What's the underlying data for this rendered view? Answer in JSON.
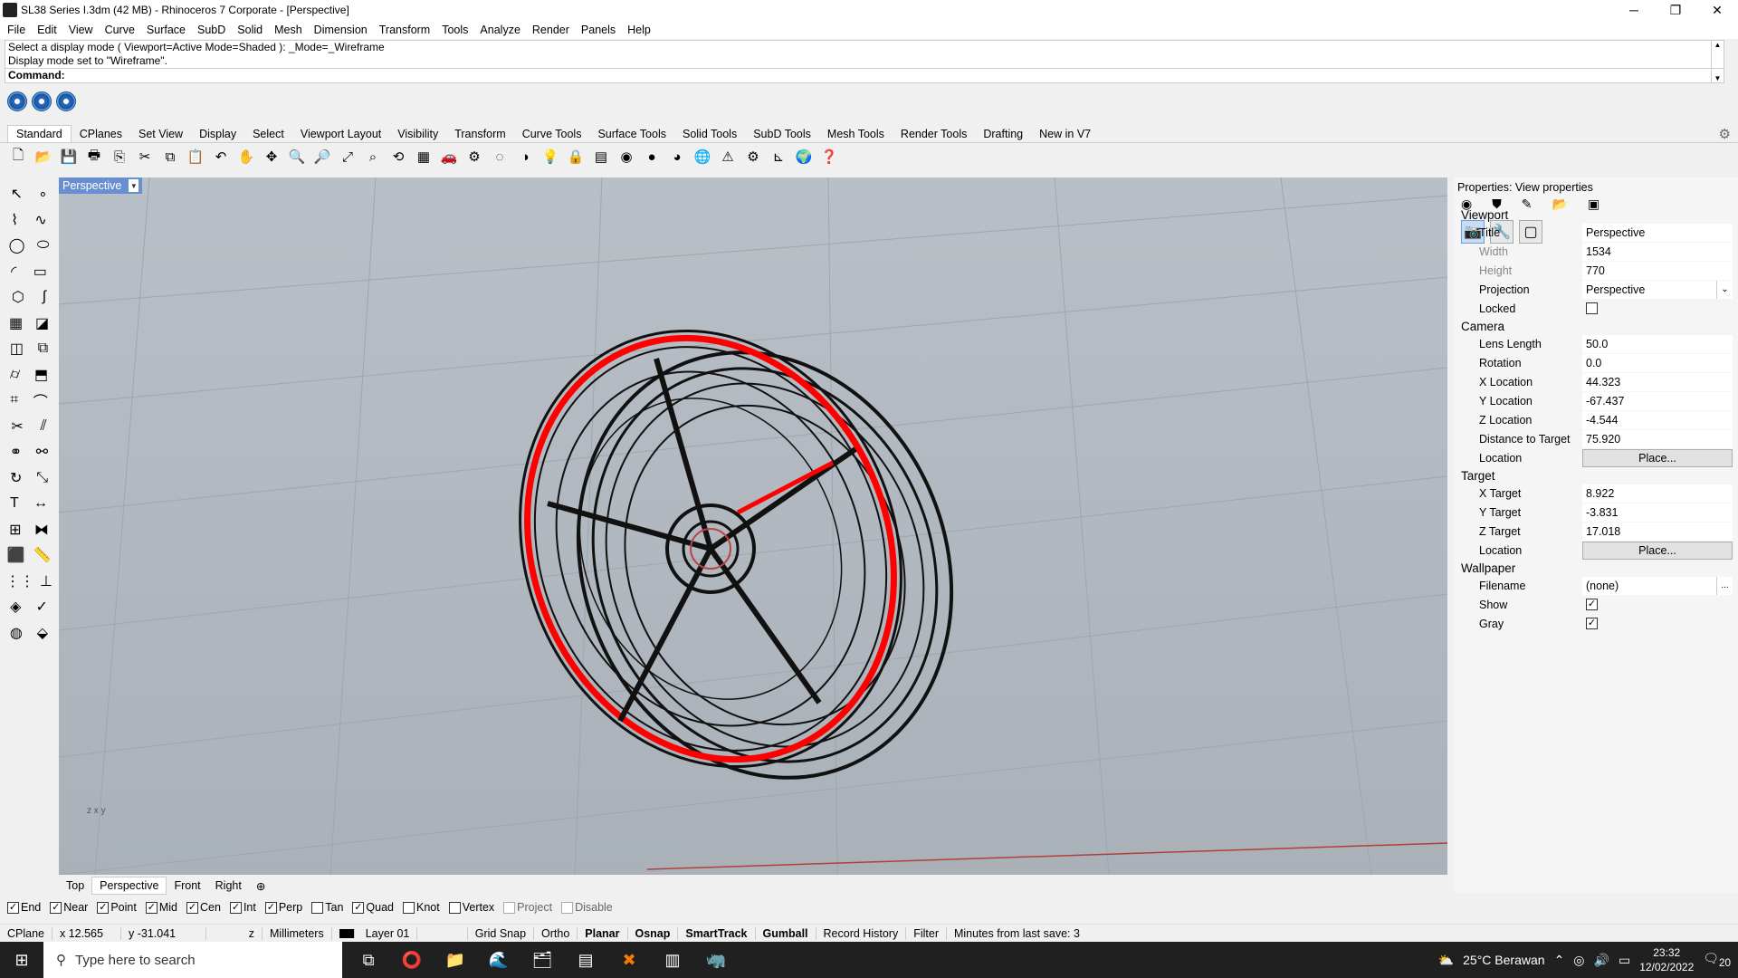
{
  "window": {
    "title": "SL38 Series I.3dm (42 MB) - Rhinoceros 7 Corporate - [Perspective]"
  },
  "menu": [
    "File",
    "Edit",
    "View",
    "Curve",
    "Surface",
    "SubD",
    "Solid",
    "Mesh",
    "Dimension",
    "Transform",
    "Tools",
    "Analyze",
    "Render",
    "Panels",
    "Help"
  ],
  "command": {
    "history1": "Select a display mode ( Viewport=Active  Mode=Shaded ): _Mode=_Wireframe",
    "history2": "Display mode set to \"Wireframe\".",
    "prompt": "Command:"
  },
  "tabs": [
    "Standard",
    "CPlanes",
    "Set View",
    "Display",
    "Select",
    "Viewport Layout",
    "Visibility",
    "Transform",
    "Curve Tools",
    "Surface Tools",
    "Solid Tools",
    "SubD Tools",
    "Mesh Tools",
    "Render Tools",
    "Drafting",
    "New in V7"
  ],
  "viewport": {
    "name": "Perspective",
    "axis_z": "z",
    "axis_x": "x",
    "axis_y": "y"
  },
  "viewtabs": [
    "Top",
    "Perspective",
    "Front",
    "Right"
  ],
  "properties": {
    "header": "Properties: View properties",
    "viewport_section": "Viewport",
    "title_label": "Title",
    "title_value": "Perspective",
    "width_label": "Width",
    "width_value": "1534",
    "height_label": "Height",
    "height_value": "770",
    "projection_label": "Projection",
    "projection_value": "Perspective",
    "locked_label": "Locked",
    "camera_section": "Camera",
    "lens_label": "Lens Length",
    "lens_value": "50.0",
    "rotation_label": "Rotation",
    "rotation_value": "0.0",
    "xloc_label": "X Location",
    "xloc_value": "44.323",
    "yloc_label": "Y Location",
    "yloc_value": "-67.437",
    "zloc_label": "Z Location",
    "zloc_value": "-4.544",
    "dist_label": "Distance to Target",
    "dist_value": "75.920",
    "location_label": "Location",
    "place_button": "Place...",
    "target_section": "Target",
    "xt_label": "X Target",
    "xt_value": "8.922",
    "yt_label": "Y Target",
    "yt_value": "-3.831",
    "zt_label": "Z Target",
    "zt_value": "17.018",
    "tlocation_label": "Location",
    "wallpaper_section": "Wallpaper",
    "filename_label": "Filename",
    "filename_value": "(none)",
    "browse": "...",
    "show_label": "Show",
    "gray_label": "Gray"
  },
  "osnaps": [
    {
      "label": "End",
      "checked": true
    },
    {
      "label": "Near",
      "checked": true
    },
    {
      "label": "Point",
      "checked": true
    },
    {
      "label": "Mid",
      "checked": true
    },
    {
      "label": "Cen",
      "checked": true
    },
    {
      "label": "Int",
      "checked": true
    },
    {
      "label": "Perp",
      "checked": true
    },
    {
      "label": "Tan",
      "checked": false
    },
    {
      "label": "Quad",
      "checked": true
    },
    {
      "label": "Knot",
      "checked": false
    },
    {
      "label": "Vertex",
      "checked": false
    },
    {
      "label": "Project",
      "checked": false
    },
    {
      "label": "Disable",
      "checked": false
    }
  ],
  "status": {
    "cplane": "CPlane",
    "x": "x 12.565",
    "y": "y -31.041",
    "z": "z",
    "units": "Millimeters",
    "layer": "Layer 01",
    "gridsnap": "Grid Snap",
    "ortho": "Ortho",
    "planar": "Planar",
    "osnap": "Osnap",
    "smarttrack": "SmartTrack",
    "gumball": "Gumball",
    "record": "Record History",
    "filter": "Filter",
    "save": "Minutes from last save: 3"
  },
  "taskbar": {
    "search_placeholder": "Type here to search",
    "weather": "25°C  Berawan",
    "time": "23:32",
    "date": "12/02/2022",
    "notif": "20"
  },
  "colors": {
    "accent": "#6a8fd0",
    "wheel_highlight": "#ff0000"
  }
}
